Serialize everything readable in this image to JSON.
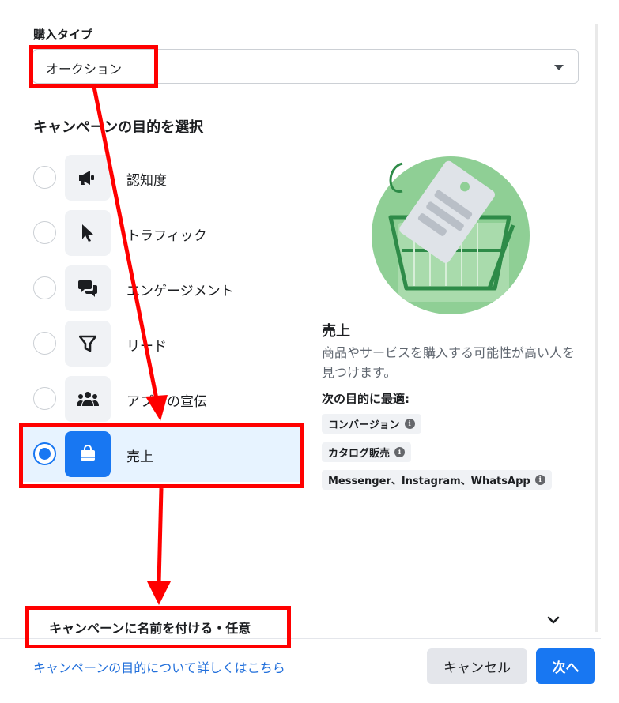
{
  "purchase_type": {
    "label": "購入タイプ",
    "value": "オークション"
  },
  "objective_section": {
    "title": "キャンペーンの目的を選択",
    "options": [
      {
        "label": "認知度",
        "icon": "megaphone-icon",
        "selected": false
      },
      {
        "label": "トラフィック",
        "icon": "cursor-icon",
        "selected": false
      },
      {
        "label": "エンゲージメント",
        "icon": "chat-bubbles-icon",
        "selected": false
      },
      {
        "label": "リード",
        "icon": "funnel-icon",
        "selected": false
      },
      {
        "label": "アプリの宣伝",
        "icon": "people-icon",
        "selected": false
      },
      {
        "label": "売上",
        "icon": "shopping-bag-icon",
        "selected": true
      }
    ]
  },
  "detail": {
    "title": "売上",
    "description": "商品やサービスを購入する可能性が高い人を見つけます。",
    "best_for_title": "次の目的に最適:",
    "tags": [
      "コンバージョン",
      "カタログ販売",
      "Messenger、Instagram、WhatsApp"
    ]
  },
  "campaign_name": {
    "label": "キャンペーンに名前を付ける・任意"
  },
  "footer": {
    "learn_more": "キャンペーンの目的について詳しくはこちら",
    "cancel": "キャンセル",
    "next": "次へ"
  },
  "colors": {
    "accent": "#1877f2",
    "annotation": "#ff0000",
    "illustration": "#8fcf95"
  }
}
